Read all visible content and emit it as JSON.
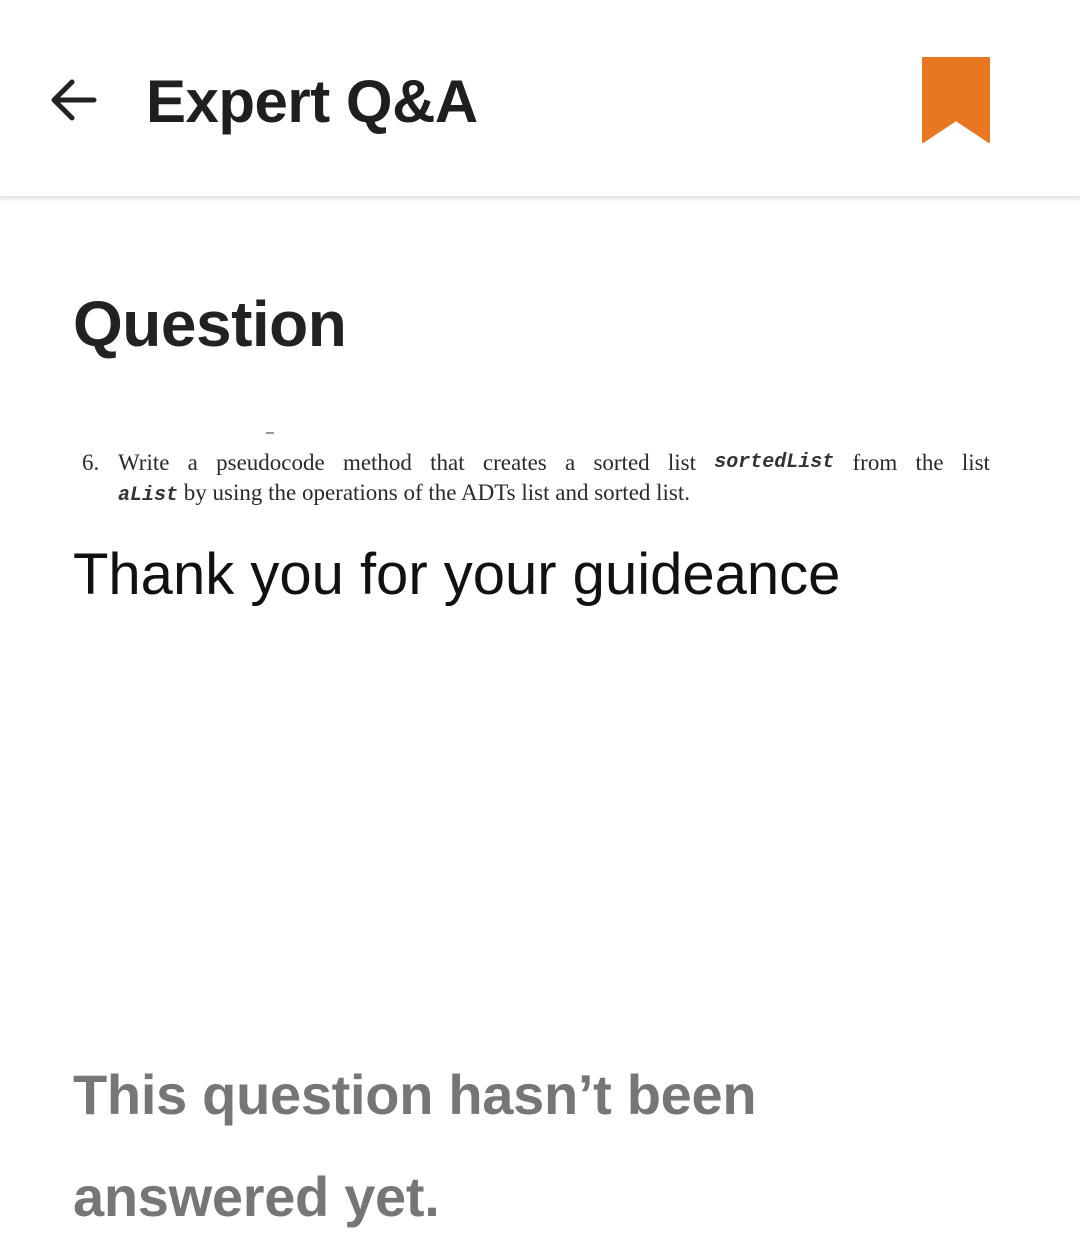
{
  "header": {
    "title": "Expert Q&A",
    "back_icon": "arrow-left-icon",
    "bookmark_icon": "bookmark-icon",
    "bookmark_color": "#E87722"
  },
  "question": {
    "heading": "Question",
    "image_text": {
      "number": "6.",
      "line1_words": [
        "Write",
        "a",
        "pseudocode",
        "method",
        "that",
        "creates",
        "a",
        "sorted",
        "list",
        "sortedList",
        "from",
        "the",
        "list"
      ],
      "line2_code": "aList",
      "line2_rest": " by using the operations of the ADTs list and sorted list."
    },
    "text": "Thank you for your guideance"
  },
  "status": {
    "unanswered_message": "This question hasn’t been answered yet."
  }
}
